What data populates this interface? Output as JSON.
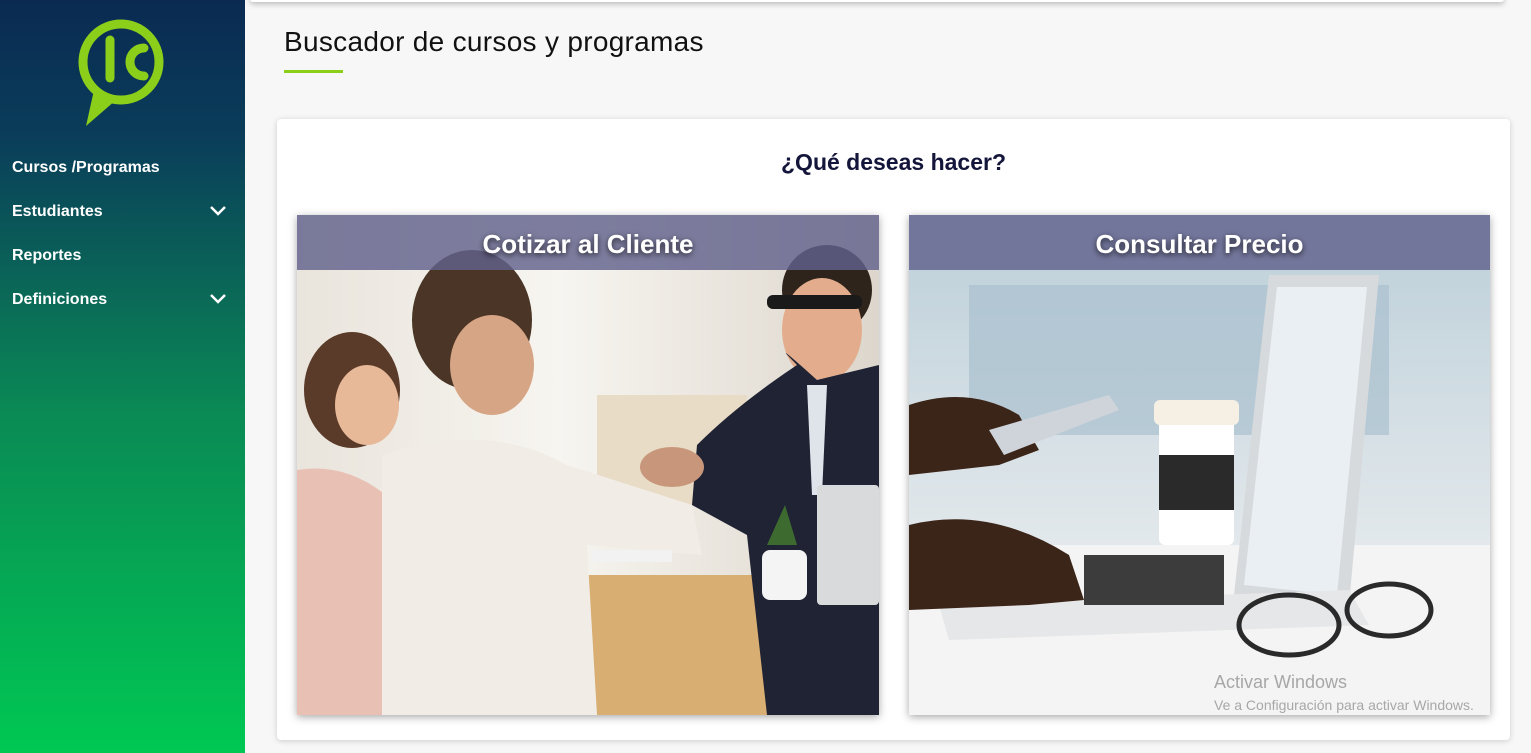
{
  "sidebar": {
    "logo_text": "lc",
    "items": [
      {
        "label": "Cursos /Programas",
        "has_chevron": false
      },
      {
        "label": "Estudiantes",
        "has_chevron": true
      },
      {
        "label": "Reportes",
        "has_chevron": false
      },
      {
        "label": "Definiciones",
        "has_chevron": true
      }
    ]
  },
  "page": {
    "title": "Buscador de cursos y programas"
  },
  "card": {
    "heading": "¿Qué deseas hacer?",
    "tiles": [
      {
        "label": "Cotizar al Cliente",
        "image": "business-handshake-photo"
      },
      {
        "label": "Consultar Precio",
        "image": "laptop-phone-coffee-photo"
      }
    ]
  },
  "watermark": {
    "line1": "Activar Windows",
    "line2": "Ve a Configuración para activar Windows."
  },
  "colors": {
    "accent_green": "#8ccf1a",
    "sidebar_top": "#0a2a52",
    "sidebar_bottom": "#00c853",
    "heading": "#14153a"
  }
}
